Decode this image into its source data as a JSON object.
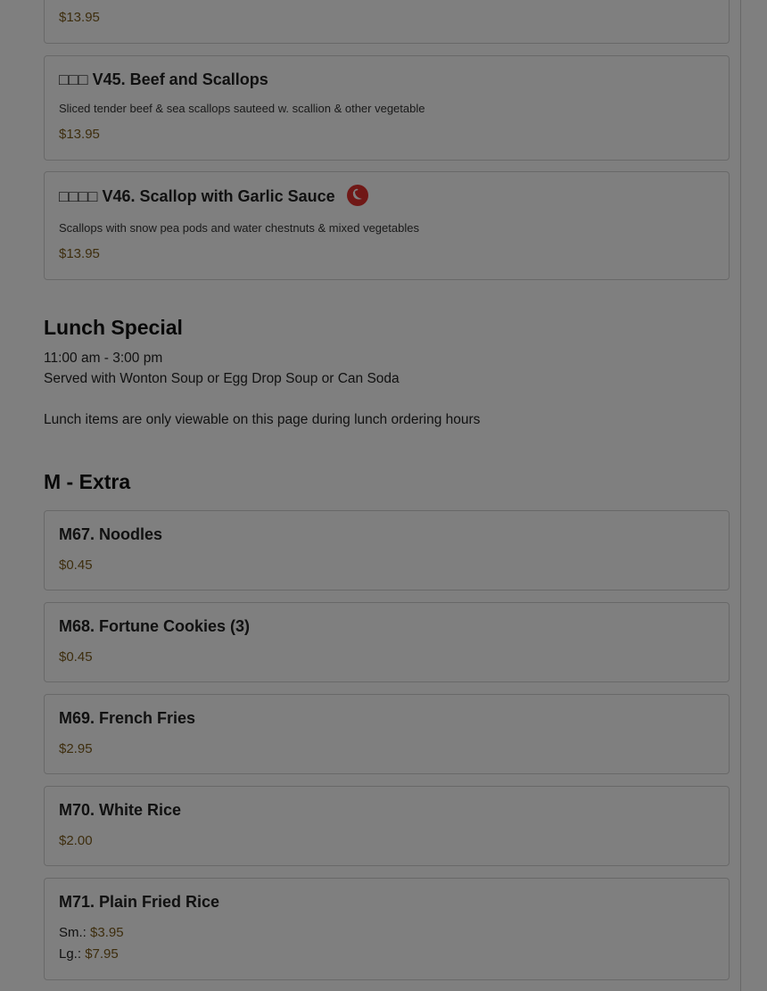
{
  "top_card": {
    "price": "$13.95"
  },
  "items_v": [
    {
      "name_prefix": "□□□",
      "name": "V45. Beef and Scallops",
      "description": "Sliced tender beef & sea scallops sauteed w. scallion & other vegetable",
      "price": "$13.95",
      "spicy": false
    },
    {
      "name_prefix": "□□□□",
      "name": "V46. Scallop with Garlic Sauce",
      "description": "Scallops with snow pea pods and water chestnuts & mixed vegetables",
      "price": "$13.95",
      "spicy": true,
      "spicy_icon": "chili-pepper-icon"
    }
  ],
  "lunch_special": {
    "title": "Lunch Special",
    "hours": "11:00 am - 3:00 pm",
    "served_with": "Served with Wonton Soup or Egg Drop Soup or Can Soda",
    "notice": "Lunch items are only viewable on this page during lunch ordering hours"
  },
  "extra": {
    "title": "M - Extra",
    "items": [
      {
        "name": "M67. Noodles",
        "price": "$0.45"
      },
      {
        "name": "M68. Fortune Cookies (3)",
        "price": "$0.45"
      },
      {
        "name": "M69. French Fries",
        "price": "$2.95"
      },
      {
        "name": "M70. White Rice",
        "price": "$2.00"
      },
      {
        "name": "M71. Plain Fried Rice",
        "sizes": [
          {
            "label": "Sm.:",
            "price": "$3.95"
          },
          {
            "label": "Lg.:",
            "price": "$7.95"
          }
        ]
      }
    ]
  },
  "colors": {
    "price": "#7a5a1a",
    "spicy_badge": "#e0302c",
    "overlay": "rgba(0,0,0,0.5)"
  }
}
